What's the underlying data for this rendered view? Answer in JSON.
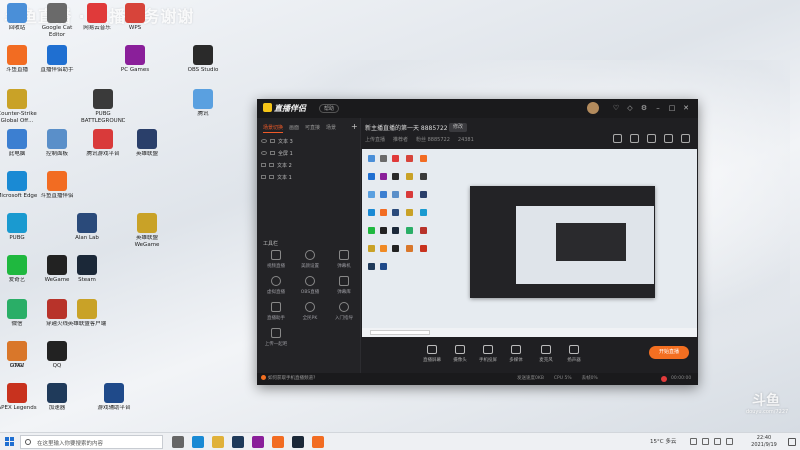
{
  "overlay": {
    "stream_title": "斗鱼直播 · 主播任务谢谢"
  },
  "desktop_icons": [
    {
      "label": "回收站",
      "color": "#4a8fd8"
    },
    {
      "label": "Google Cat Editor",
      "color": "#6a6a6a"
    },
    {
      "label": "网易云音乐",
      "color": "#e03a3a"
    },
    {
      "label": "WPS",
      "color": "#d7443a"
    },
    {
      "label": "斗鱼直播",
      "color": "#f26c22"
    },
    {
      "label": "直播伴侣助手",
      "color": "#1f6fd1"
    },
    {
      "label": "PC Games",
      "color": "#8a1f9a"
    },
    {
      "label": "OBS Studio",
      "color": "#2a2a2a"
    },
    {
      "label": "Counter-Strike Global Off...",
      "color": "#c9a227"
    },
    {
      "label": "PUBG BATTLEGROUNDS",
      "color": "#3a3a3a"
    },
    {
      "label": "腾讯",
      "color": "#5aa0e0"
    },
    {
      "label": "此电脑",
      "color": "#3c7fd1"
    },
    {
      "label": "控制面板",
      "color": "#5a8fc9"
    },
    {
      "label": "腾讯游戏平台",
      "color": "#d93a3a"
    },
    {
      "label": "英雄联盟",
      "color": "#2a3f6a"
    },
    {
      "label": "Microsoft Edge",
      "color": "#1a8ad4"
    },
    {
      "label": "斗鱼直播伴侣",
      "color": "#f26c22"
    },
    {
      "label": "Alan Lab",
      "color": "#2a4a7a"
    },
    {
      "label": "英雄联盟WeGame",
      "color": "#c9a227"
    },
    {
      "label": "PUBG",
      "color": "#1a9ad0"
    },
    {
      "label": "爱奇艺",
      "color": "#1fb83f"
    },
    {
      "label": "WeGame",
      "color": "#222"
    },
    {
      "label": "Steam",
      "color": "#1b2838"
    },
    {
      "label": "微信",
      "color": "#2aae67"
    },
    {
      "label": "穿越火线",
      "color": "#b8332a"
    },
    {
      "label": "英雄联盟客户端",
      "color": "#c9a227"
    },
    {
      "label": "GTAV",
      "color": "#f08a24"
    },
    {
      "label": "QQ",
      "color": "#222"
    },
    {
      "label": "DXGI",
      "color": "#d9772a"
    },
    {
      "label": "APEX Legends",
      "color": "#c8321e"
    },
    {
      "label": "加速器",
      "color": "#1f3a5a"
    },
    {
      "label": "游戏辅助平台",
      "color": "#1f4a8a"
    }
  ],
  "app": {
    "logo_text": "直播伴侣",
    "version_label": "帮助",
    "room_title": "新主播直播的第一天 8885722",
    "room_tag": "修改",
    "room_sub": [
      "上传直播",
      "推荐者",
      "粉丝 8885722",
      "24381"
    ],
    "left_tabs": [
      "场景切换",
      "画面",
      "可直接",
      "场景"
    ],
    "scenes": [
      "文本 3",
      "全屏 1",
      "文本 2",
      "文本 1"
    ],
    "tool_header": "工具栏",
    "tools": [
      {
        "label": "视频直播"
      },
      {
        "label": "美颜设置"
      },
      {
        "label": "弹幕机"
      },
      {
        "label": "虚拟直播"
      },
      {
        "label": "OBS直播"
      },
      {
        "label": "弹幕库"
      },
      {
        "label": "直播助手"
      },
      {
        "label": "全民PK"
      },
      {
        "label": "入门指导"
      },
      {
        "label": "上传一起吧"
      }
    ],
    "controls": [
      {
        "label": "直播屏幕"
      },
      {
        "label": "摄像头"
      },
      {
        "label": "手机投屏"
      },
      {
        "label": "多媒体"
      },
      {
        "label": "麦克风"
      },
      {
        "label": "扬声器"
      }
    ],
    "go_live": "开始直播",
    "status_help": "如何获取手机直播频道?",
    "status_stats": [
      "发送速度0KB",
      "CPU 5%",
      "丢帧0%",
      "0:00"
    ],
    "timer": "00:00:00"
  },
  "douyu_mark": {
    "big": "斗鱼",
    "small": "douyu.com/7227"
  },
  "taskbar": {
    "search_placeholder": "在这里输入你要搜索的内容",
    "weather": "15°C 多云",
    "time": "22:40",
    "date": "2021/9/19",
    "task_icons": [
      {
        "name": "task-view-icon",
        "color": "#666"
      },
      {
        "name": "edge-icon",
        "color": "#1a8ad4"
      },
      {
        "name": "file-explorer-icon",
        "color": "#e0b13a"
      },
      {
        "name": "media-icon",
        "color": "#1f3a5a"
      },
      {
        "name": "pc-games-icon",
        "color": "#8a1f9a"
      },
      {
        "name": "douyu-icon",
        "color": "#f26c22"
      },
      {
        "name": "steam-icon",
        "color": "#1b2838"
      },
      {
        "name": "live-assistant-icon",
        "color": "#f26c22"
      }
    ]
  }
}
